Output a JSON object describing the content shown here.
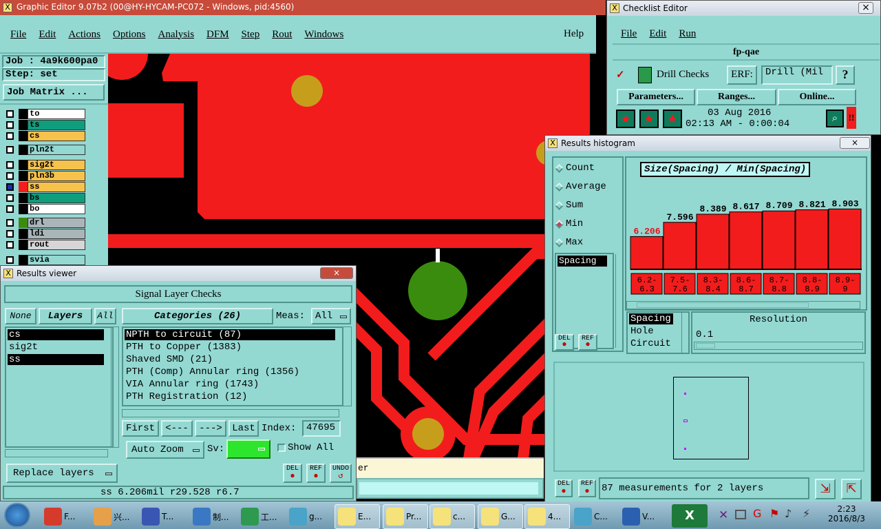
{
  "graphic_editor": {
    "title": "Graphic Editor 9.07b2 (00@HY-HYCAM-PC072 - Windows, pid:4560)",
    "menu": [
      "File",
      "Edit",
      "Actions",
      "Options",
      "Analysis",
      "DFM",
      "Step",
      "Rout",
      "Windows"
    ],
    "help": "Help",
    "job": "Job : 4a9k600pa0",
    "step": "Step: set",
    "job_matrix": "Job Matrix ...",
    "layers": [
      {
        "name": "to",
        "color": "#ffffff"
      },
      {
        "name": "ts",
        "color": "#0f9e7c"
      },
      {
        "name": "cs",
        "color": "#f7c24b"
      },
      {
        "name": "pln2t",
        "color": "#94d8d2"
      },
      {
        "name": "sig2t",
        "color": "#f7c24b"
      },
      {
        "name": "pln3b",
        "color": "#f7c24b"
      },
      {
        "name": "ss",
        "color": "#f7c24b"
      },
      {
        "name": "bs",
        "color": "#0f9e7c"
      },
      {
        "name": "bo",
        "color": "#ffffff"
      },
      {
        "name": "drl",
        "color": "#a9b5b8"
      },
      {
        "name": "ldi",
        "color": "#a9b5b8"
      },
      {
        "name": "rout",
        "color": "#d6d6d6"
      },
      {
        "name": "svia",
        "color": "#94d8d2"
      }
    ],
    "status_fragment": "er"
  },
  "results_viewer": {
    "title": "Results viewer",
    "header": "Signal Layer Checks",
    "none_btn": "None",
    "layers_btn": "Layers",
    "all_btn": "All",
    "categories_btn": "Categories (26)",
    "meas_label": "Meas:",
    "meas_value": "All",
    "layer_list": [
      "cs",
      "sig2t",
      "ss"
    ],
    "categories": [
      "NPTH to circuit (87)",
      "PTH to Copper (1383)",
      "Shaved SMD (21)",
      "PTH (Comp) Annular ring (1356)",
      "VIA Annular ring (1743)",
      "PTH Registration (12)"
    ],
    "first": "First",
    "prev": "<---",
    "next": "--->",
    "last": "Last",
    "index_label": "Index:",
    "index_value": "47695",
    "auto_zoom": "Auto Zoom",
    "sv_label": "Sv:",
    "show_all": "Show All",
    "replace_layers": "Replace layers",
    "del": "DEL",
    "ref": "REF",
    "undo": "UNDO",
    "status": "ss 6.206mil  r29.528  r6.7"
  },
  "checklist_editor": {
    "title": "Checklist Editor",
    "menu": [
      "File",
      "Edit",
      "Run"
    ],
    "checklist_name": "fp-qae",
    "drill_checks": "Drill Checks",
    "erf_label": "ERF:",
    "erf_value": "Drill (Mil",
    "help_btn": "?",
    "parameters": "Parameters...",
    "ranges": "Ranges...",
    "online": "Online...",
    "date": "03 Aug 2016",
    "time": "02:13 AM - 0:00:04"
  },
  "histogram": {
    "title": "Results histogram",
    "radios": [
      {
        "label": "Count",
        "selected": false
      },
      {
        "label": "Average",
        "selected": false
      },
      {
        "label": "Sum",
        "selected": false
      },
      {
        "label": "Min",
        "selected": true
      },
      {
        "label": "Max",
        "selected": false
      }
    ],
    "list_items": [
      "Spacing"
    ],
    "metric_items": [
      "Spacing",
      "Hole",
      "Circuit"
    ],
    "resolution_label": "Resolution",
    "resolution_value": "0.1",
    "footer": "87 measurements for 2 layers",
    "del": "DEL",
    "ref": "REF"
  },
  "chart_data": {
    "type": "bar",
    "title": "Size(Spacing) / Min(Spacing)",
    "categories": [
      "6.2-6.3",
      "7.5-7.6",
      "8.3-8.4",
      "8.6-8.7",
      "8.7-8.8",
      "8.8-8.9",
      "8.9-9"
    ],
    "bin_labels_top": [
      "6.2-",
      "7.5-",
      "8.3-",
      "8.6-",
      "8.7-",
      "8.8-",
      "8.9-"
    ],
    "bin_labels_bottom": [
      "6.3",
      "7.6",
      "8.4",
      "8.7",
      "8.8",
      "8.9",
      "9"
    ],
    "values": [
      6.206,
      7.596,
      8.389,
      8.617,
      8.709,
      8.821,
      8.903
    ],
    "value_labels": [
      "6.206",
      "7.596",
      "8.389",
      "8.617",
      "8.709",
      "8.821",
      "8.903"
    ],
    "ylim": [
      3.0,
      9.6
    ],
    "bar_color": "#f21c1c",
    "highlight_color": "#f21c1c"
  },
  "taskbar": {
    "items": [
      {
        "label": "F...",
        "color": "#d43b2b"
      },
      {
        "label": "兴...",
        "color": "#e6a04a"
      },
      {
        "label": "T...",
        "color": "#3a56b3"
      },
      {
        "label": "制...",
        "color": "#3b78c4"
      },
      {
        "label": "工...",
        "color": "#2e9a4f"
      },
      {
        "label": "g...",
        "color": "#4aa3c9"
      },
      {
        "label": "E...",
        "color": "#f5e27a"
      },
      {
        "label": "Pr...",
        "color": "#f5e27a"
      },
      {
        "label": "c...",
        "color": "#f5e27a"
      },
      {
        "label": "G...",
        "color": "#f5e27a"
      },
      {
        "label": "4...",
        "color": "#f5e27a"
      },
      {
        "label": "C...",
        "color": "#4aa3c9"
      },
      {
        "label": "V...",
        "color": "#2b5fb0"
      }
    ],
    "clock_time": "2:23",
    "clock_date": "2016/8/3"
  }
}
